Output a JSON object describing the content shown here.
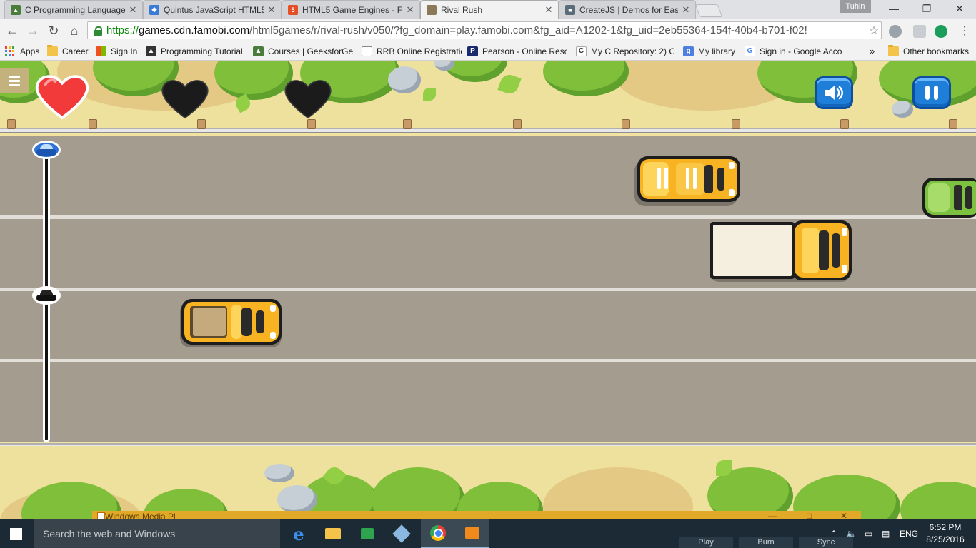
{
  "browser": {
    "tabs": [
      {
        "title": "C Programming Language",
        "favicon": "graduation-cap-icon",
        "favicon_color": "#4a7c3b",
        "active": false
      },
      {
        "title": "Quintus JavaScript HTML5",
        "favicon": "quintus-icon",
        "favicon_color": "#3a7bd5",
        "active": false
      },
      {
        "title": "HTML5 Game Engines - Fi",
        "favicon": "html5-shield-icon",
        "favicon_color": "#e34f26",
        "active": false
      },
      {
        "title": "Rival Rush",
        "favicon": "rival-rush-icon",
        "favicon_color": "#8a7a5a",
        "active": true
      },
      {
        "title": "CreateJS | Demos for Ease",
        "favicon": "createjs-cube-icon",
        "favicon_color": "#5a6b7a",
        "active": false
      }
    ],
    "profile_name": "Tuhin",
    "url": {
      "scheme": "https://",
      "host": "games.cdn.famobi.com",
      "path": "/html5games/r/rival-rush/v050/?fg_domain=play.famobi.com&fg_aid=A1202-1&fg_uid=2eb55364-154f-40b4-b701-f02!"
    },
    "bookmarks": [
      {
        "label": "Apps",
        "icon": "apps-grid-icon"
      },
      {
        "label": "Career",
        "icon": "folder-icon"
      },
      {
        "label": "Sign In",
        "icon": "microsoft-icon"
      },
      {
        "label": "Programming Tutorial",
        "icon": "tutorials-icon"
      },
      {
        "label": "Courses | GeeksforGe",
        "icon": "graduation-cap-icon"
      },
      {
        "label": "RRB Online Registratic",
        "icon": "page-icon"
      },
      {
        "label": "Pearson - Online Reso",
        "icon": "pearson-icon",
        "badge": "P"
      },
      {
        "label": "My C Repository: 2) C",
        "icon": "c-icon",
        "badge": "C"
      },
      {
        "label": "My library",
        "icon": "google-scholar-icon",
        "badge": "g"
      },
      {
        "label": "Sign in - Google Acco",
        "icon": "google-icon",
        "badge": "G"
      }
    ],
    "bookmarks_overflow": "»",
    "other_bookmarks": "Other bookmarks"
  },
  "game": {
    "title": "Rival Rush",
    "lives_total": 3,
    "lives_remaining": 1,
    "race_progress": {
      "player_fraction": 0.5,
      "rival_fraction": 1.0
    },
    "buttons": {
      "menu": "menu-icon",
      "sound": "speaker-icon",
      "pause": "pause-icon"
    },
    "colors": {
      "heart_full": "#f23a3a",
      "heart_empty": "#1b1b1b",
      "button_blue": "#1e7ed8",
      "road": "#a49d8f"
    }
  },
  "taskbar": {
    "search_placeholder": "Search the web and Windows",
    "language": "ENG",
    "time": "6:52 PM",
    "date": "8/25/2016",
    "media_player_title": "Windows Media Pl",
    "peek_buttons": [
      "Play",
      "Burn",
      "Sync"
    ]
  }
}
